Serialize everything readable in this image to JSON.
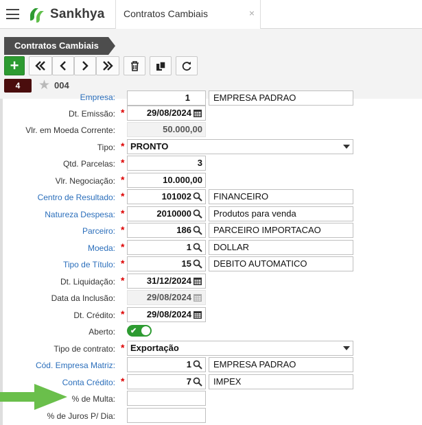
{
  "header": {
    "brand": "Sankhya",
    "tab_title": "Contratos Cambiais",
    "tab_close": "×"
  },
  "toolbar": {
    "breadcrumb": "Contratos Cambiais",
    "add_label": "+",
    "record_count": "4",
    "record_id": "004"
  },
  "form": {
    "empresa": {
      "label": "Empresa:",
      "code": "1",
      "desc": "EMPRESA PADRAO"
    },
    "dt_emissao": {
      "label": "Dt. Emissão:",
      "value": "29/08/2024"
    },
    "vlr_moeda": {
      "label": "Vlr. em Moeda Corrente:",
      "value": "50.000,00"
    },
    "tipo": {
      "label": "Tipo:",
      "value": "PRONTO"
    },
    "qtd_parcelas": {
      "label": "Qtd. Parcelas:",
      "value": "3"
    },
    "vlr_negociacao": {
      "label": "Vlr. Negociação:",
      "value": "10.000,00"
    },
    "centro_resultado": {
      "label": "Centro de Resultado:",
      "code": "101002",
      "desc": "FINANCEIRO"
    },
    "natureza": {
      "label": "Natureza Despesa:",
      "code": "2010000",
      "desc": "Produtos para venda"
    },
    "parceiro": {
      "label": "Parceiro:",
      "code": "186",
      "desc": "PARCEIRO IMPORTACAO"
    },
    "moeda": {
      "label": "Moeda:",
      "code": "1",
      "desc": "DOLLAR"
    },
    "tipo_titulo": {
      "label": "Tipo de Título:",
      "code": "15",
      "desc": "DEBITO AUTOMATICO"
    },
    "dt_liquidacao": {
      "label": "Dt. Liquidação:",
      "value": "31/12/2024"
    },
    "data_inclusao": {
      "label": "Data da Inclusão:",
      "value": "29/08/2024"
    },
    "dt_credito": {
      "label": "Dt. Crédito:",
      "value": "29/08/2024"
    },
    "aberto": {
      "label": "Aberto:",
      "checked": true
    },
    "tipo_contrato": {
      "label": "Tipo de contrato:",
      "value": "Exportação"
    },
    "empresa_matriz": {
      "label": "Cód. Empresa Matriz:",
      "code": "1",
      "desc": "EMPRESA PADRAO"
    },
    "conta_credito": {
      "label": "Conta Crédito:",
      "code": "7",
      "desc": "IMPEX"
    },
    "multa": {
      "label": "% de Multa:",
      "value": ""
    },
    "juros": {
      "label": "% de Juros P/ Dia:",
      "value": ""
    },
    "required_mark": "*"
  },
  "colors": {
    "accent": "#2d9b31",
    "link": "#2a6ebb",
    "required": "#dd0000",
    "record_badge": "#4a0d0d"
  }
}
